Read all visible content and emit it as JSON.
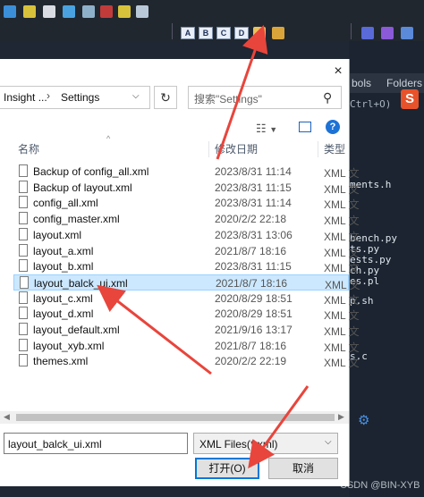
{
  "toolbar": {
    "letter_buttons": [
      "A",
      "B",
      "C",
      "D"
    ]
  },
  "background": {
    "tabs": [
      "bols",
      "Folders"
    ],
    "editor_snippets": [
      "Ctrl+O)",
      "ments.h",
      "bench.py",
      "ts.py",
      "ests.py",
      "ch.py",
      "es.pl",
      "p.sh",
      "s.c"
    ],
    "watermark": "CSDN @BIN-XYB"
  },
  "dialog": {
    "close_label": "×",
    "address": {
      "root": "Insight ...",
      "separator": "›",
      "current": "Settings"
    },
    "search_placeholder": "搜索\"Settings\"",
    "columns": {
      "name": "名称",
      "date": "修改日期",
      "type": "类型"
    },
    "files": [
      {
        "name": "Backup of config_all.xml",
        "date": "2023/8/31 11:14",
        "type": "XML 文"
      },
      {
        "name": "Backup of layout.xml",
        "date": "2023/8/31 11:15",
        "type": "XML 文"
      },
      {
        "name": "config_all.xml",
        "date": "2023/8/31 11:14",
        "type": "XML 文"
      },
      {
        "name": "config_master.xml",
        "date": "2020/2/2 22:18",
        "type": "XML 文"
      },
      {
        "name": "layout.xml",
        "date": "2023/8/31 13:06",
        "type": "XML 文"
      },
      {
        "name": "layout_a.xml",
        "date": "2021/8/7 18:16",
        "type": "XML 文"
      },
      {
        "name": "layout_b.xml",
        "date": "2023/8/31 11:15",
        "type": "XML 文"
      },
      {
        "name": "layout_balck_ui.xml",
        "date": "2021/8/7 18:16",
        "type": "XML 文"
      },
      {
        "name": "layout_c.xml",
        "date": "2020/8/29 18:51",
        "type": "XML 文"
      },
      {
        "name": "layout_d.xml",
        "date": "2020/8/29 18:51",
        "type": "XML 文"
      },
      {
        "name": "layout_default.xml",
        "date": "2021/9/16 13:17",
        "type": "XML 文"
      },
      {
        "name": "layout_xyb.xml",
        "date": "2021/8/7 18:16",
        "type": "XML 文"
      },
      {
        "name": "themes.xml",
        "date": "2020/2/2 22:19",
        "type": "XML 文"
      }
    ],
    "selected_file": "layout_balck_ui.xml",
    "filename_value": "layout_balck_ui.xml",
    "filetype_value": "XML Files(*.xml)",
    "open_button": "打开(O)",
    "cancel_button": "取消"
  },
  "colors": {
    "selection_bg": "#cce8ff",
    "annotation_arrow": "#e8453c",
    "primary_border": "#0078d7"
  }
}
